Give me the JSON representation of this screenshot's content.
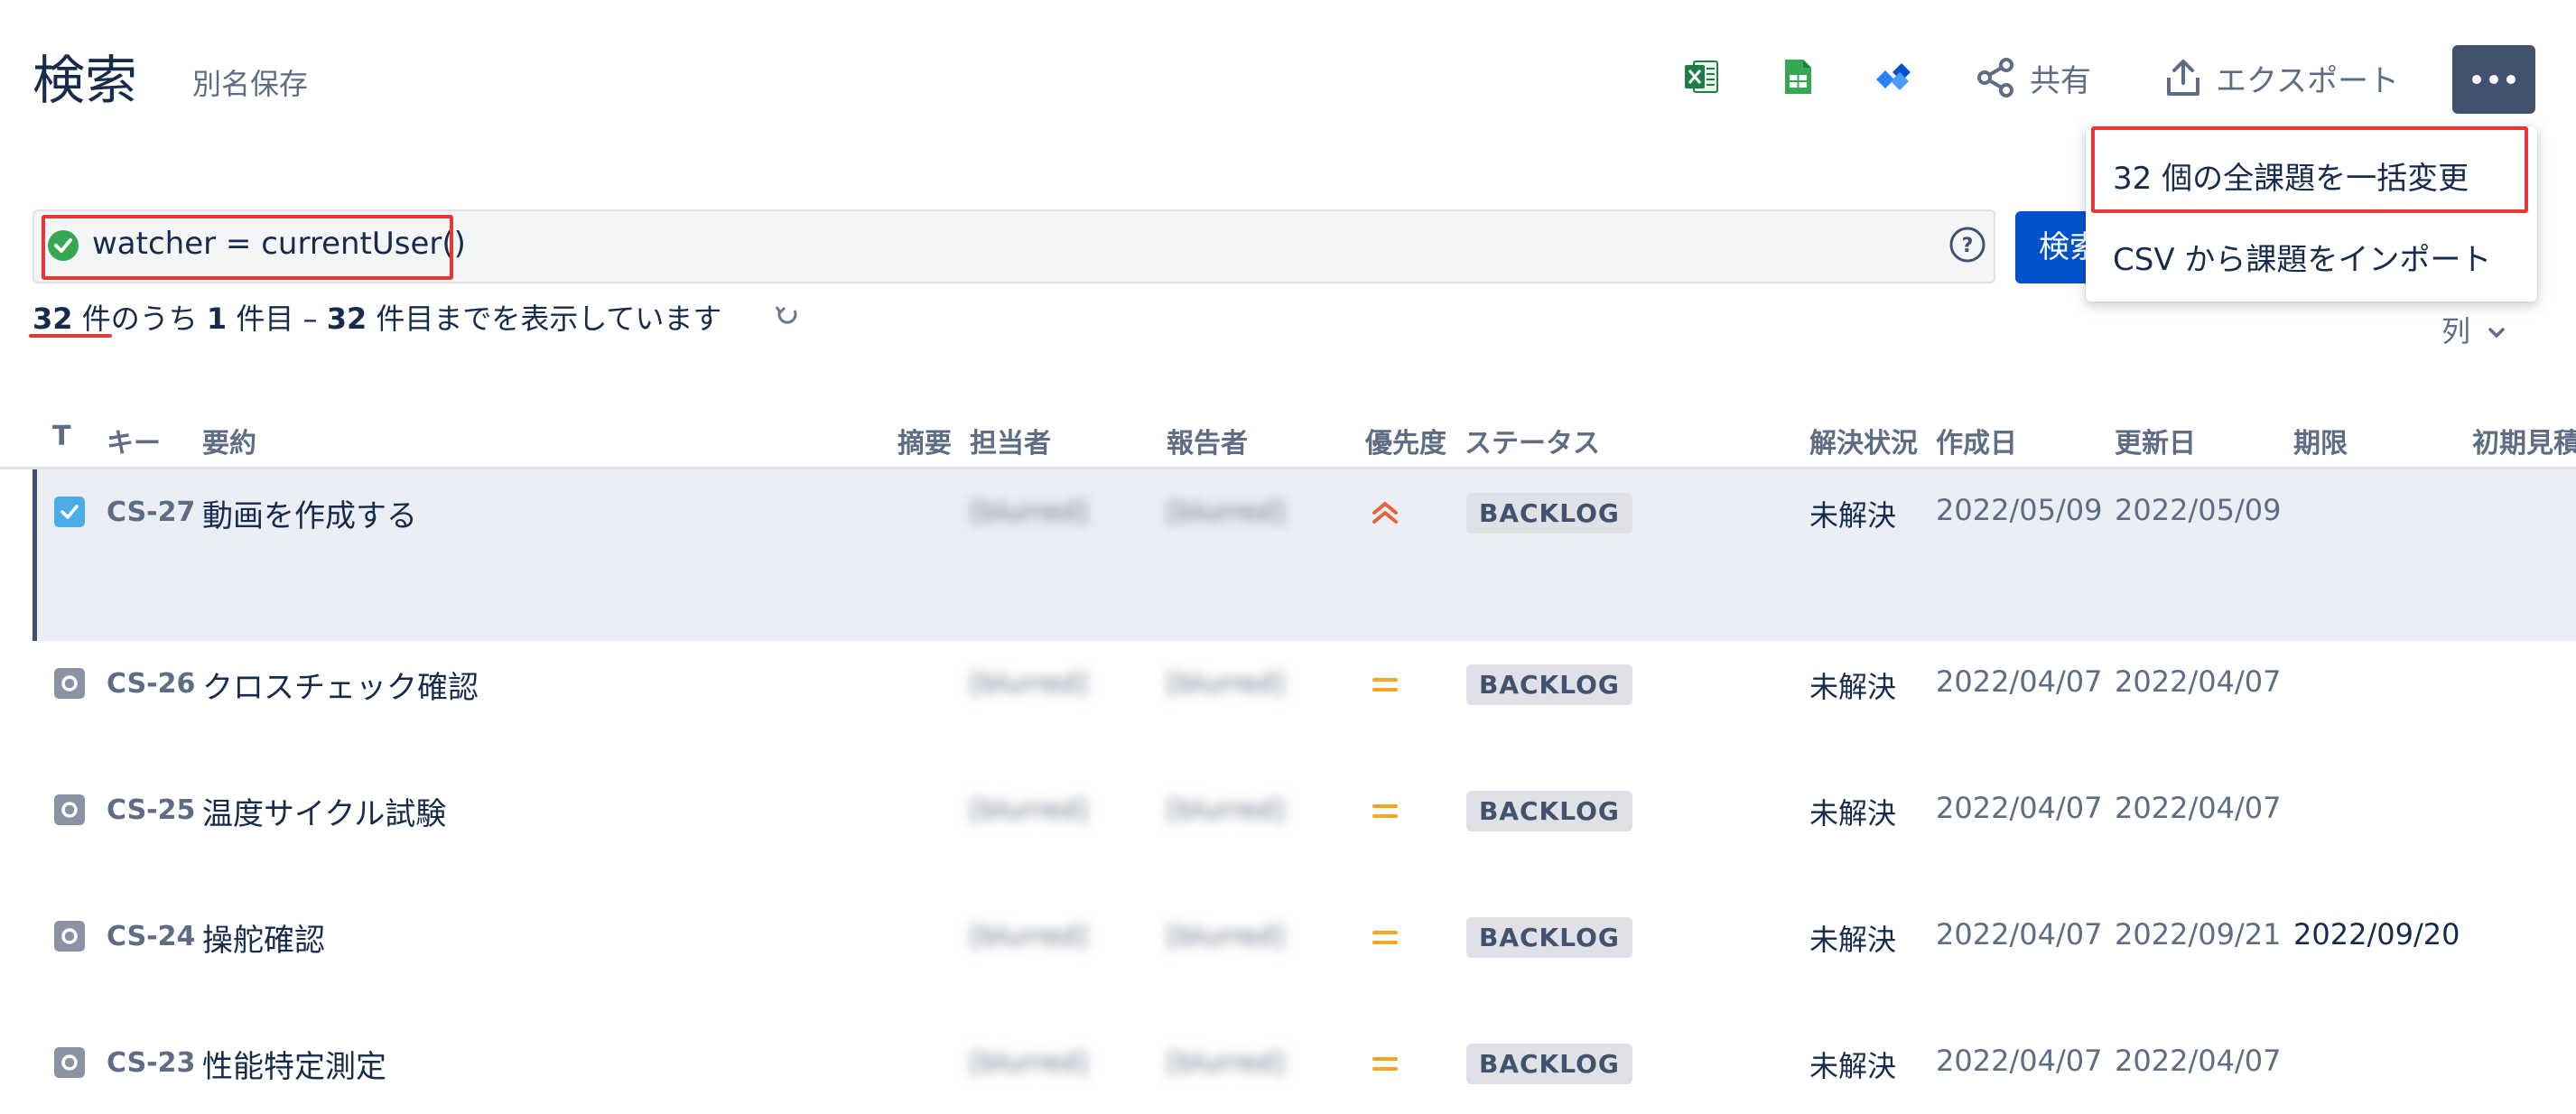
{
  "header": {
    "title": "検索",
    "save_as": "別名保存",
    "share_label": "共有",
    "export_label": "エクスポート",
    "icons": [
      "excel-icon",
      "google-sheets-icon",
      "confluence-icon",
      "share-icon",
      "export-icon",
      "more-icon"
    ]
  },
  "dropdown": {
    "items": [
      "32 個の全課題を一括変更",
      "CSV から課題をインポート"
    ]
  },
  "search": {
    "jql": "watcher = currentUser()",
    "button_label": "検索"
  },
  "results": {
    "total": "32",
    "unit1": " 件のうち ",
    "from": "1",
    "unit2": " 件目 – ",
    "to": "32",
    "unit3": " 件目までを表示しています"
  },
  "columns_button": "列",
  "table": {
    "headers": [
      "T",
      "キー",
      "要約",
      "摘要",
      "担当者",
      "報告者",
      "優先度",
      "ステータス",
      "解決状況",
      "作成日",
      "更新日",
      "期限",
      "初期見積"
    ],
    "rows": [
      {
        "key": "CS-27",
        "summary": "動画を作成する",
        "assignee": "[blurred]",
        "reporter": "[blurred]",
        "priority": "highest",
        "status": "BACKLOG",
        "resolution": "未解決",
        "created": "2022/05/09",
        "updated": "2022/05/09",
        "due": ""
      },
      {
        "key": "CS-26",
        "summary": "クロスチェック確認",
        "assignee": "[blurred]",
        "reporter": "[blurred]",
        "priority": "medium",
        "status": "BACKLOG",
        "resolution": "未解決",
        "created": "2022/04/07",
        "updated": "2022/04/07",
        "due": ""
      },
      {
        "key": "CS-25",
        "summary": "温度サイクル試験",
        "assignee": "[blurred]",
        "reporter": "[blurred]",
        "priority": "medium",
        "status": "BACKLOG",
        "resolution": "未解決",
        "created": "2022/04/07",
        "updated": "2022/04/07",
        "due": ""
      },
      {
        "key": "CS-24",
        "summary": "操舵確認",
        "assignee": "[blurred]",
        "reporter": "[blurred]",
        "priority": "medium",
        "status": "BACKLOG",
        "resolution": "未解決",
        "created": "2022/04/07",
        "updated": "2022/09/21",
        "due": "2022/09/20"
      },
      {
        "key": "CS-23",
        "summary": "性能特定測定",
        "assignee": "[blurred]",
        "reporter": "[blurred]",
        "priority": "medium",
        "status": "BACKLOG",
        "resolution": "未解決",
        "created": "2022/04/07",
        "updated": "2022/04/07",
        "due": ""
      }
    ]
  },
  "colors": {
    "accent": "#0052cc",
    "highlight_red": "#e53935",
    "priority_high": "#e8643c",
    "priority_medium": "#f5a623",
    "selected_row": "#ebeef5"
  }
}
